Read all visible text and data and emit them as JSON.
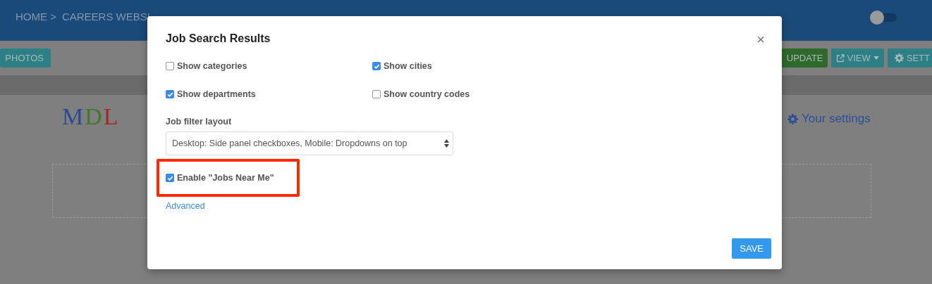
{
  "breadcrumb": [
    "HOME >",
    "CAREERS WEBSI"
  ],
  "header_toggle": {
    "on": false
  },
  "toolbar": {
    "left_buttons": [
      {
        "label": "PHOTOS"
      }
    ],
    "right_buttons": [
      {
        "label": "UPDATE",
        "kind": "update"
      },
      {
        "label": "VIEW",
        "kind": "view"
      },
      {
        "label": "SETT",
        "kind": "settings"
      }
    ]
  },
  "logo": [
    {
      "letter": "M",
      "color": "#2a4b93"
    },
    {
      "letter": "D",
      "color": "#3f7a2a"
    },
    {
      "letter": "L",
      "color": "#a02a23"
    }
  ],
  "settings_link": "Your settings",
  "dialog": {
    "title": "Job Search Results",
    "close": "×",
    "options": [
      {
        "label": "Show categories",
        "checked": false
      },
      {
        "label": "Show cities",
        "checked": true
      },
      {
        "label": "Show departments",
        "checked": true
      },
      {
        "label": "Show country codes",
        "checked": false
      }
    ],
    "filter_layout": {
      "label": "Job filter layout",
      "value": "Desktop: Side panel checkboxes, Mobile: Dropdowns on top"
    },
    "near_me": {
      "label": "Enable \"Jobs Near Me\"",
      "checked": true,
      "highlighted": true
    },
    "advanced_link": "Advanced",
    "save_button": "SAVE"
  }
}
